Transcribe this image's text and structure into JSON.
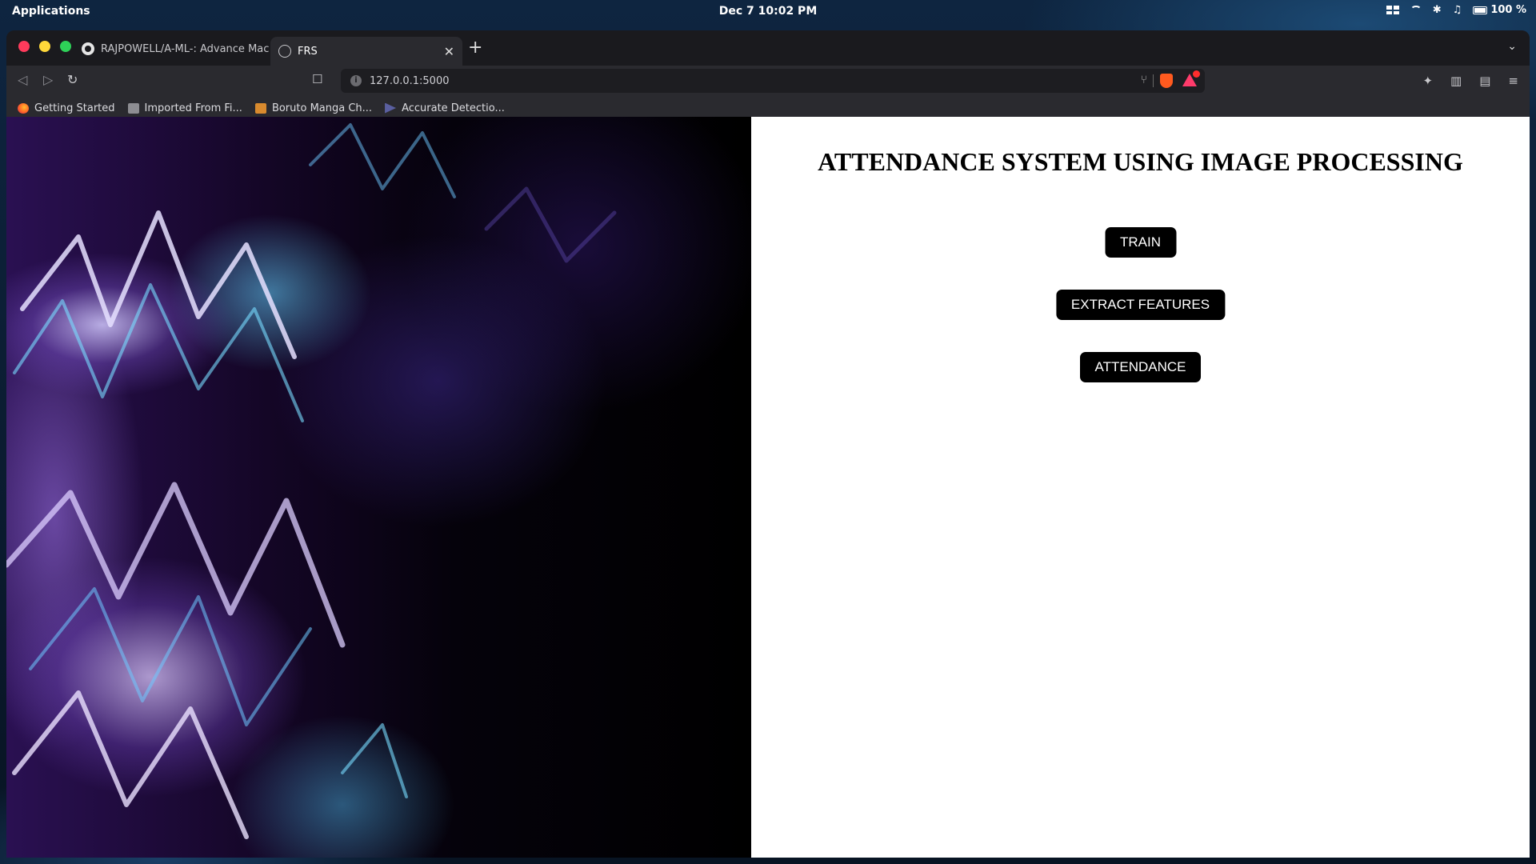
{
  "desktop": {
    "applications_label": "Applications",
    "clock": "Dec 7  10:02 PM",
    "battery": "100 %"
  },
  "browser": {
    "tabs": [
      {
        "title": "RAJPOWELL/A-ML-: Advance Machi",
        "icon": "github-icon",
        "active": false
      },
      {
        "title": "FRS",
        "icon": "globe-icon",
        "active": true
      }
    ],
    "url": "127.0.0.1:5000",
    "bookmarks": [
      {
        "label": "Getting Started",
        "icon": "firefox-icon"
      },
      {
        "label": "Imported From Fi...",
        "icon": "folder-icon"
      },
      {
        "label": "Boruto Manga Ch...",
        "icon": "manga-icon"
      },
      {
        "label": "Accurate Detectio...",
        "icon": "play-icon"
      }
    ]
  },
  "page": {
    "title": "ATTENDANCE SYSTEM USING IMAGE PROCESSING",
    "buttons": {
      "train": "TRAIN",
      "extract": "EXTRACT FEATURES",
      "attendance": "ATTENDANCE"
    }
  },
  "colors": {
    "button_bg": "#000000",
    "button_text": "#ffffff",
    "page_bg": "#ffffff"
  }
}
